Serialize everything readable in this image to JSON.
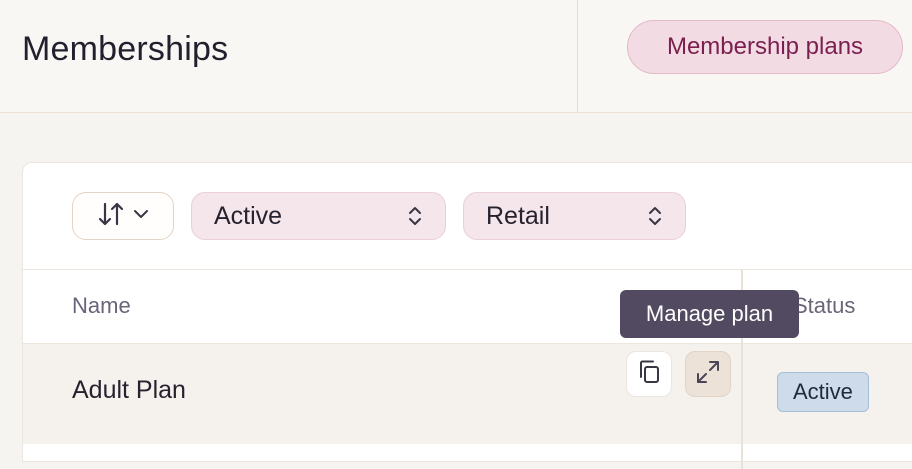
{
  "header": {
    "title": "Memberships",
    "plans_button": "Membership plans"
  },
  "filters": {
    "sort_icon": "sort-arrows-icon",
    "status_select": "Active",
    "type_select": "Retail"
  },
  "table": {
    "columns": [
      "Name",
      "Status"
    ],
    "rows": [
      {
        "name": "Adult Plan",
        "status": "Active"
      }
    ]
  },
  "row_actions": {
    "copy_icon": "copy-icon",
    "expand_icon": "expand-icon",
    "tooltip": "Manage plan"
  },
  "colors": {
    "accent": "#7a1f4f",
    "accent_bg": "#f3dbe3",
    "badge_bg": "#cddbeb",
    "tooltip_bg": "#514a61"
  }
}
